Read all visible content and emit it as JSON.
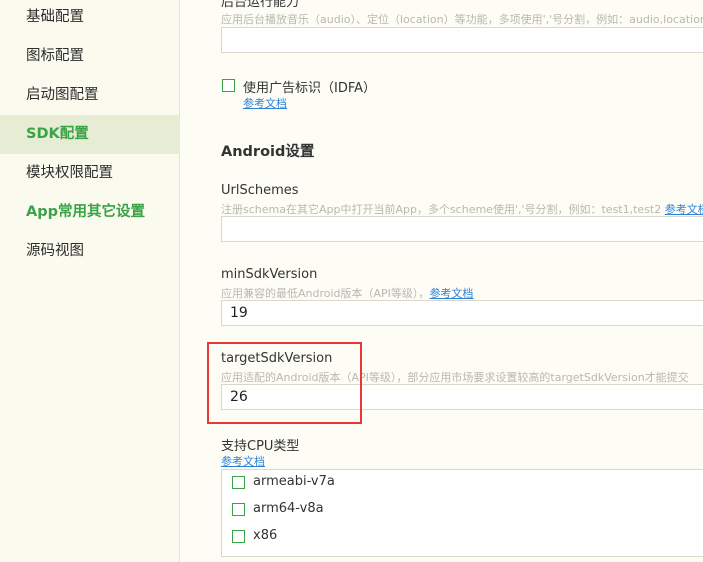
{
  "sidebar": {
    "items": [
      {
        "label": "基础配置"
      },
      {
        "label": "图标配置"
      },
      {
        "label": "启动图配置"
      },
      {
        "label": "SDK配置"
      },
      {
        "label": "模块权限配置"
      },
      {
        "label": "App常用其它设置"
      },
      {
        "label": "源码视图"
      }
    ]
  },
  "background_run": {
    "label": "后台运行能力",
    "hint": "应用后台播放音乐（audio）、定位（location）等功能，多项使用','号分割，例如：audio,location",
    "value": ""
  },
  "idfa": {
    "label": "使用广告标识（IDFA）",
    "doc_link": "参考文档"
  },
  "android": {
    "section_title": "Android设置",
    "url_schemes": {
      "label": "UrlSchemes",
      "hint": "注册schema在其它App中打开当前App，多个scheme使用','号分割，例如：test1,test2",
      "doc_link": "参考文档",
      "value": ""
    },
    "min_sdk": {
      "label": "minSdkVersion",
      "hint": "应用兼容的最低Android版本（API等级），",
      "doc_link": "参考文档",
      "value": "19"
    },
    "target_sdk": {
      "label": "targetSdkVersion",
      "hint": "应用适配的Android版本（API等级），部分应用市场要求设置较高的targetSdkVersion才能提交",
      "value": "26"
    },
    "cpu": {
      "label": "支持CPU类型",
      "doc_link": "参考文档",
      "options": [
        {
          "label": "armeabi-v7a"
        },
        {
          "label": "arm64-v8a"
        },
        {
          "label": "x86"
        }
      ]
    }
  },
  "colors": {
    "accent": "#3aa345",
    "link": "#2e82d6",
    "highlight": "#e53935"
  }
}
